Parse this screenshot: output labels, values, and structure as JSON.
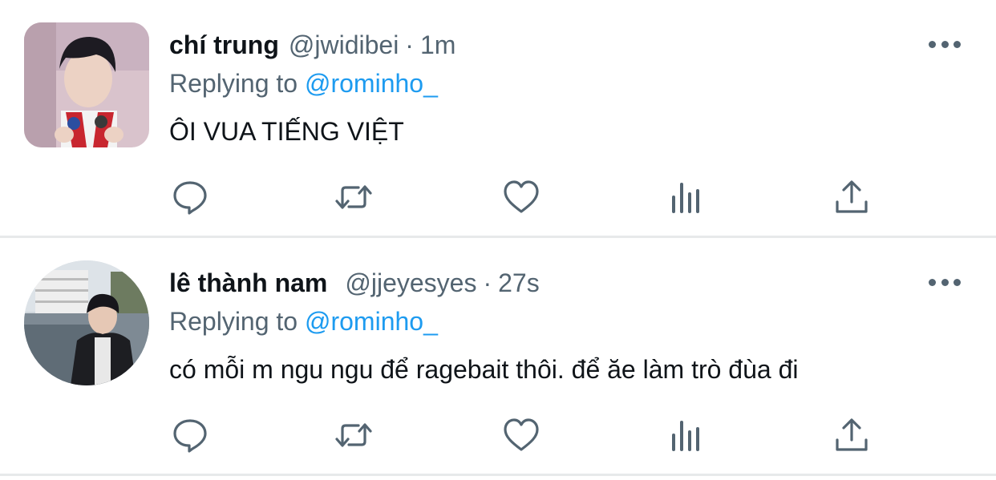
{
  "tweets": [
    {
      "display_name": "chí trung",
      "handle": "@jwidibei",
      "separator": "·",
      "time": "1m",
      "reply_prefix": "Replying to",
      "reply_to": "@rominho_",
      "text": "ÔI VUA TIẾNG VIỆT"
    },
    {
      "display_name": "lê thành nam",
      "handle": "@jjeyesyes",
      "separator": "·",
      "time": "27s",
      "reply_prefix": "Replying to",
      "reply_to": "@rominho_",
      "text": "có mỗi m ngu ngu để ragebait thôi. để ăe làm trò đùa đi"
    }
  ],
  "icons": [
    "reply-icon",
    "retweet-icon",
    "like-icon",
    "views-icon",
    "share-icon",
    "more-icon"
  ],
  "colors": {
    "text_primary": "#0f1419",
    "text_secondary": "#536471",
    "link": "#1d9bf0",
    "divider": "#e7e9ea",
    "background": "#ffffff"
  }
}
